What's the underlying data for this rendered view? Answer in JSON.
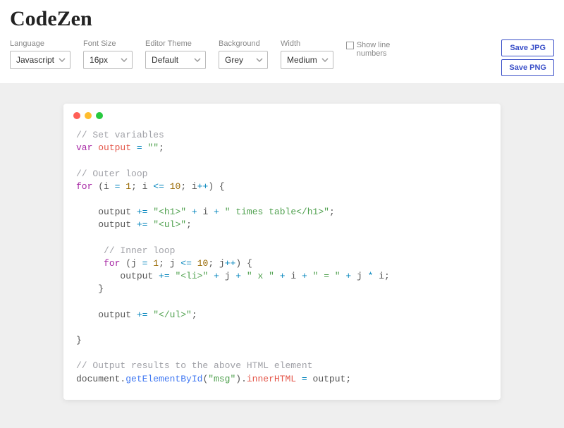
{
  "app": {
    "title": "CodeZen"
  },
  "toolbar": {
    "language": {
      "label": "Language",
      "value": "Javascript"
    },
    "fontSize": {
      "label": "Font Size",
      "value": "16px"
    },
    "theme": {
      "label": "Editor Theme",
      "value": "Default"
    },
    "background": {
      "label": "Background",
      "value": "Grey"
    },
    "width": {
      "label": "Width",
      "value": "Medium"
    },
    "showLineNumbers": {
      "label": "Show line numbers",
      "checked": false
    },
    "saveJpg": "Save JPG",
    "savePng": "Save PNG"
  },
  "colors": {
    "stageBg": "#efefef",
    "accent": "#3a4fc8"
  },
  "code": {
    "lines": [
      [
        [
          "comment",
          "// Set variables"
        ]
      ],
      [
        [
          "kw",
          "var"
        ],
        [
          "txt",
          " "
        ],
        [
          "var",
          "output"
        ],
        [
          "txt",
          " "
        ],
        [
          "op",
          "="
        ],
        [
          "txt",
          " "
        ],
        [
          "str",
          "\"\""
        ],
        [
          "txt",
          ";"
        ]
      ],
      [
        [
          "txt",
          ""
        ]
      ],
      [
        [
          "comment",
          "// Outer loop"
        ]
      ],
      [
        [
          "kw",
          "for"
        ],
        [
          "txt",
          " (i "
        ],
        [
          "op",
          "="
        ],
        [
          "txt",
          " "
        ],
        [
          "num",
          "1"
        ],
        [
          "txt",
          "; i "
        ],
        [
          "op",
          "<="
        ],
        [
          "txt",
          " "
        ],
        [
          "num",
          "10"
        ],
        [
          "txt",
          "; i"
        ],
        [
          "op",
          "++"
        ],
        [
          "txt",
          ") {"
        ]
      ],
      [
        [
          "txt",
          ""
        ]
      ],
      [
        [
          "txt",
          "    output "
        ],
        [
          "op",
          "+="
        ],
        [
          "txt",
          " "
        ],
        [
          "str",
          "\"<h1>\""
        ],
        [
          "txt",
          " "
        ],
        [
          "op",
          "+"
        ],
        [
          "txt",
          " i "
        ],
        [
          "op",
          "+"
        ],
        [
          "txt",
          " "
        ],
        [
          "str",
          "\" times table</h1>\""
        ],
        [
          "txt",
          ";"
        ]
      ],
      [
        [
          "txt",
          "    output "
        ],
        [
          "op",
          "+="
        ],
        [
          "txt",
          " "
        ],
        [
          "str",
          "\"<ul>\""
        ],
        [
          "txt",
          ";"
        ]
      ],
      [
        [
          "txt",
          ""
        ]
      ],
      [
        [
          "txt",
          "     "
        ],
        [
          "comment",
          "// Inner loop"
        ]
      ],
      [
        [
          "txt",
          "     "
        ],
        [
          "kw",
          "for"
        ],
        [
          "txt",
          " (j "
        ],
        [
          "op",
          "="
        ],
        [
          "txt",
          " "
        ],
        [
          "num",
          "1"
        ],
        [
          "txt",
          "; j "
        ],
        [
          "op",
          "<="
        ],
        [
          "txt",
          " "
        ],
        [
          "num",
          "10"
        ],
        [
          "txt",
          "; j"
        ],
        [
          "op",
          "++"
        ],
        [
          "txt",
          ") {"
        ]
      ],
      [
        [
          "txt",
          "        output "
        ],
        [
          "op",
          "+="
        ],
        [
          "txt",
          " "
        ],
        [
          "str",
          "\"<li>\""
        ],
        [
          "txt",
          " "
        ],
        [
          "op",
          "+"
        ],
        [
          "txt",
          " j "
        ],
        [
          "op",
          "+"
        ],
        [
          "txt",
          " "
        ],
        [
          "str",
          "\" x \""
        ],
        [
          "txt",
          " "
        ],
        [
          "op",
          "+"
        ],
        [
          "txt",
          " i "
        ],
        [
          "op",
          "+"
        ],
        [
          "txt",
          " "
        ],
        [
          "str",
          "\" = \""
        ],
        [
          "txt",
          " "
        ],
        [
          "op",
          "+"
        ],
        [
          "txt",
          " j "
        ],
        [
          "op",
          "*"
        ],
        [
          "txt",
          " i;"
        ]
      ],
      [
        [
          "txt",
          "    }"
        ]
      ],
      [
        [
          "txt",
          ""
        ]
      ],
      [
        [
          "txt",
          "    output "
        ],
        [
          "op",
          "+="
        ],
        [
          "txt",
          " "
        ],
        [
          "str",
          "\"</ul>\""
        ],
        [
          "txt",
          ";"
        ]
      ],
      [
        [
          "txt",
          ""
        ]
      ],
      [
        [
          "txt",
          "}"
        ]
      ],
      [
        [
          "txt",
          ""
        ]
      ],
      [
        [
          "comment",
          "// Output results to the above HTML element"
        ]
      ],
      [
        [
          "txt",
          "document."
        ],
        [
          "fn",
          "getElementById"
        ],
        [
          "txt",
          "("
        ],
        [
          "str",
          "\"msg\""
        ],
        [
          "txt",
          ")."
        ],
        [
          "var",
          "innerHTML"
        ],
        [
          "txt",
          " "
        ],
        [
          "op",
          "="
        ],
        [
          "txt",
          " output;"
        ]
      ]
    ]
  }
}
